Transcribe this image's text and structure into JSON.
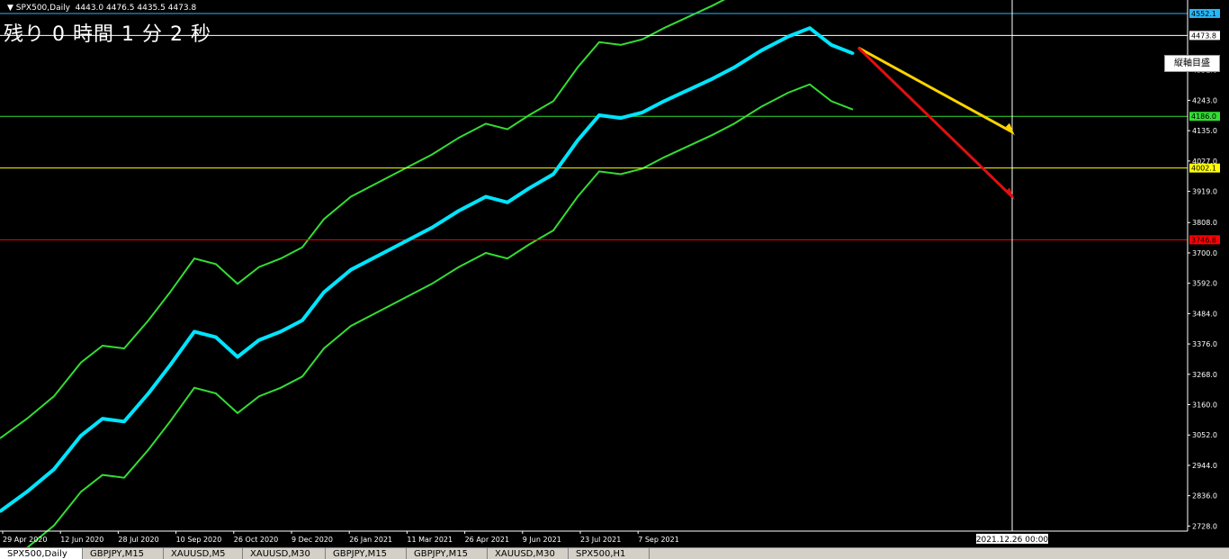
{
  "window": {
    "symbol_label": "SPX500,Daily",
    "ohlc": "4443.0 4476.5 4435.5 4473.8",
    "countdown": "残り 0 時間 1 分 2 秒",
    "axis_button": "縦軸目盛"
  },
  "colors": {
    "background": "#000000",
    "price_line": "#00e5ff",
    "price_line_down": "#ff00ff",
    "channel": "#33dd33",
    "hline_blue": "#29b6f6",
    "hline_green": "#33dd33",
    "hline_yellow": "#ffff00",
    "hline_red": "#ff0000",
    "arrow_yellow": "#ffd400",
    "arrow_red": "#e01010"
  },
  "chart_data": {
    "type": "line",
    "title": "",
    "x_ticks": [
      "29 Apr 2020",
      "12 Jun 2020",
      "28 Jul 2020",
      "10 Sep 2020",
      "26 Oct 2020",
      "9 Dec 2020",
      "26 Jan 2021",
      "11 Mar 2021",
      "26 Apr 2021",
      "9 Jun 2021",
      "23 Jul 2021",
      "7 Sep 2021"
    ],
    "y_ticks": [
      "4552.1",
      "4473.8",
      "4351.0",
      "4243.0",
      "4186.0",
      "4135.0",
      "4027.0",
      "4002.1",
      "3919.0",
      "3808.0",
      "3746.8",
      "3700.0",
      "3592.0",
      "3484.0",
      "3376.0",
      "3268.0",
      "3160.0",
      "3052.0",
      "2944.0",
      "2836.0",
      "2728.0"
    ],
    "ylim": [
      2710,
      4600
    ],
    "xlim": [
      0,
      440
    ],
    "series": [
      {
        "values": [
          [
            0,
            2780
          ],
          [
            10,
            2850
          ],
          [
            20,
            2930
          ],
          [
            30,
            3050
          ],
          [
            38,
            3110
          ],
          [
            46,
            3100
          ],
          [
            55,
            3200
          ],
          [
            63,
            3300
          ],
          [
            72,
            3420
          ],
          [
            80,
            3400
          ],
          [
            88,
            3330
          ],
          [
            96,
            3390
          ],
          [
            104,
            3420
          ],
          [
            112,
            3460
          ],
          [
            120,
            3560
          ],
          [
            130,
            3640
          ],
          [
            140,
            3690
          ],
          [
            150,
            3740
          ],
          [
            160,
            3790
          ],
          [
            170,
            3850
          ],
          [
            180,
            3900
          ],
          [
            188,
            3880
          ],
          [
            196,
            3930
          ],
          [
            205,
            3980
          ],
          [
            214,
            4100
          ],
          [
            222,
            4190
          ],
          [
            230,
            4180
          ],
          [
            238,
            4200
          ],
          [
            246,
            4240
          ],
          [
            255,
            4280
          ],
          [
            264,
            4320
          ],
          [
            272,
            4360
          ],
          [
            282,
            4420
          ],
          [
            292,
            4470
          ],
          [
            300,
            4500
          ],
          [
            308,
            4440
          ],
          [
            316,
            4410
          ]
        ]
      }
    ],
    "horizontal_levels": [
      {
        "value": 4552.1,
        "label": "4552.1"
      },
      {
        "value": 4473.8,
        "label": "4473.8"
      },
      {
        "value": 4186.0,
        "label": "4186.0"
      },
      {
        "value": 4002.1,
        "label": "4002.1"
      },
      {
        "value": 3746.8,
        "label": "3746.8"
      }
    ],
    "vertical_marker": {
      "x": 375,
      "label": "2021.12.26 00:00"
    },
    "forecast_arrows": [
      {
        "color": "yellow",
        "from": [
          318,
          4430
        ],
        "to": [
          375,
          4130
        ]
      },
      {
        "color": "red",
        "from": [
          318,
          4430
        ],
        "to": [
          375,
          3900
        ]
      }
    ],
    "grid": false
  },
  "tabs": [
    "SPX500,Daily",
    "GBPJPY,M15",
    "XAUUSD,M5",
    "XAUUSD,M30",
    "GBPJPY,M15",
    "GBPJPY,M15",
    "XAUUSD,M30",
    "SPX500,H1"
  ]
}
